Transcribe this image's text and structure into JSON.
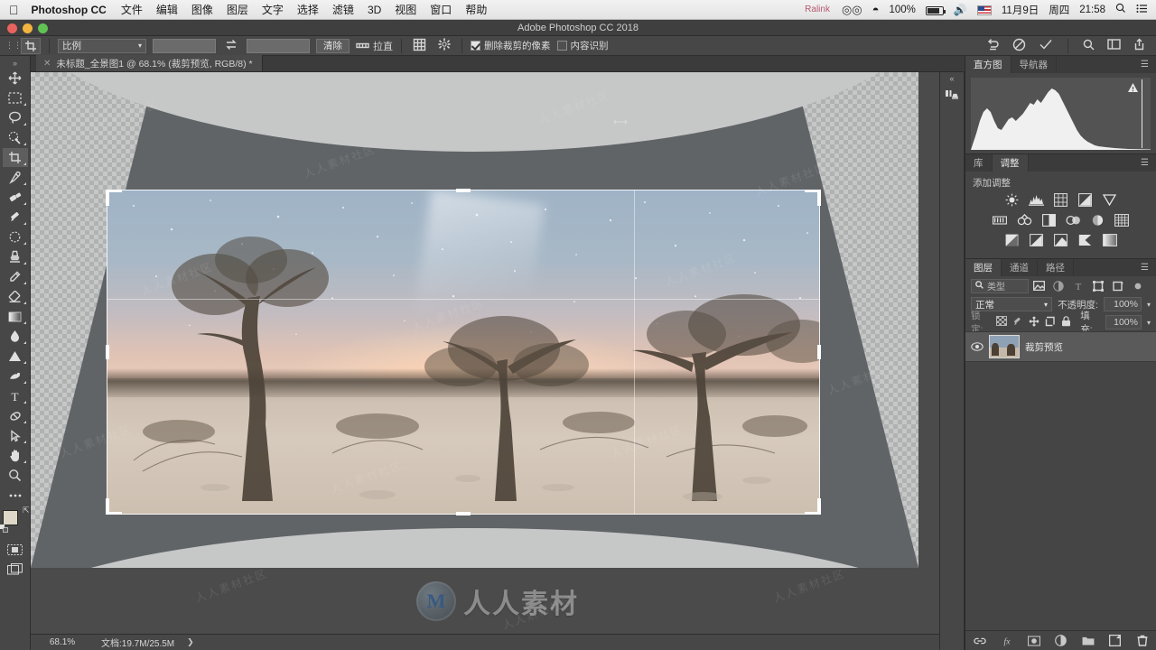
{
  "macbar": {
    "apple_icon": "apple-icon",
    "app_name": "Photoshop CC",
    "menus": [
      "文件",
      "编辑",
      "图像",
      "图层",
      "文字",
      "选择",
      "滤镜",
      "3D",
      "视图",
      "窗口",
      "帮助"
    ],
    "ralink_label": "Ralink",
    "battery_percent": "100%",
    "date": "11月9日",
    "weekday": "周四",
    "time": "21:58",
    "icons": [
      "wifi-icon",
      "battery-icon",
      "volume-icon",
      "flag-icon",
      "spotlight-search-icon",
      "notification-center-icon"
    ]
  },
  "titlebar": {
    "title": "Adobe Photoshop CC 2018",
    "window_buttons": [
      "close-button",
      "minimize-button",
      "zoom-button"
    ]
  },
  "options_bar": {
    "tool_icon": "crop-tool-icon",
    "ratio_select": {
      "label": "比例",
      "value": ""
    },
    "swap_icon": "swap-dimensions-icon",
    "width_value": "",
    "height_value": "",
    "clear_button": "清除",
    "straighten_icon": "straighten-icon",
    "straighten_label": "拉直",
    "overlay_icon": "crop-overlay-grid-icon",
    "settings_icon": "gear-icon",
    "delete_cropped_checkbox": {
      "label": "删除裁剪的像素",
      "checked": true
    },
    "content_aware_checkbox": {
      "label": "内容识别",
      "checked": false
    },
    "reset_icon": "reset-icon",
    "cancel_icon": "cancel-icon",
    "commit_icon": "commit-checkmark-icon",
    "right_icons": [
      "search-icon",
      "workspace-icon",
      "share-icon"
    ]
  },
  "document_tab": {
    "close_icon": "close-tab-icon",
    "title": "未标题_全景图1 @ 68.1% (裁剪预览, RGB/8) *"
  },
  "toolbar": {
    "collapse_icon": "expand-toolbar-icon",
    "tools": [
      {
        "name": "move-tool",
        "active": false
      },
      {
        "name": "rectangular-marquee-tool",
        "active": false
      },
      {
        "name": "lasso-tool",
        "active": false
      },
      {
        "name": "quick-selection-tool",
        "active": false
      },
      {
        "name": "crop-tool",
        "active": true
      },
      {
        "name": "eyedropper-tool",
        "active": false
      },
      {
        "name": "spot-healing-brush-tool",
        "active": false
      },
      {
        "name": "brush-tool",
        "active": false
      },
      {
        "name": "patch-tool",
        "active": false
      },
      {
        "name": "clone-stamp-tool",
        "active": false
      },
      {
        "name": "history-brush-tool",
        "active": false
      },
      {
        "name": "eraser-tool",
        "active": false
      },
      {
        "name": "gradient-tool",
        "active": false
      },
      {
        "name": "blur-tool",
        "active": false
      },
      {
        "name": "dodge-tool",
        "active": false
      },
      {
        "name": "pen-tool",
        "active": false
      },
      {
        "name": "type-tool",
        "active": false
      },
      {
        "name": "path-selection-tool",
        "active": false
      },
      {
        "name": "direct-selection-tool",
        "active": false
      },
      {
        "name": "hand-tool",
        "active": false
      },
      {
        "name": "zoom-tool",
        "active": false
      },
      {
        "name": "more-tools",
        "active": false
      }
    ],
    "foreground_color": "#ded6c6",
    "background_color": "#e6dcdc",
    "quickmask_icon": "quick-mask-icon",
    "screenmode_icon": "screen-mode-icon"
  },
  "canvas": {
    "zoom_level": "68.1%",
    "watermark_text": "人人素材",
    "watermark_logo": "renren-logo-icon",
    "tiled_watermark": "人人素材社区",
    "crop_overlay": {
      "rule_of_thirds": true,
      "handles": 8
    }
  },
  "status_bar": {
    "zoom": "68.1%",
    "doc_size": "文档:19.7M/25.5M",
    "expand_icon": "expand-status-icon"
  },
  "dock_strip": {
    "collapse_icon": "collapse-panels-icon",
    "icons": [
      "libraries-icon"
    ]
  },
  "histogram_panel": {
    "tabs": [
      {
        "label": "直方图",
        "active": true
      },
      {
        "label": "导航器",
        "active": false
      }
    ],
    "menu_icon": "panel-menu-icon",
    "warning_icon": "cache-warning-icon"
  },
  "adjustments_panel": {
    "tabs": [
      {
        "label": "库",
        "active": false
      },
      {
        "label": "调整",
        "active": true
      }
    ],
    "menu_icon": "panel-menu-icon",
    "title": "添加调整",
    "rows": [
      [
        "brightness-contrast-icon",
        "levels-icon",
        "curves-icon",
        "exposure-icon",
        "vibrance-icon"
      ],
      [
        "hue-saturation-icon",
        "color-balance-icon",
        "black-white-icon",
        "photo-filter-icon",
        "channel-mixer-icon",
        "color-lookup-icon"
      ],
      [
        "invert-icon",
        "posterize-icon",
        "threshold-icon",
        "selective-color-icon",
        "gradient-map-icon"
      ]
    ]
  },
  "layers_panel": {
    "tabs": [
      {
        "label": "图层",
        "active": true
      },
      {
        "label": "通道",
        "active": false
      },
      {
        "label": "路径",
        "active": false
      }
    ],
    "menu_icon": "panel-menu-icon",
    "filter": {
      "search_icon": "filter-search-icon",
      "label": "类型",
      "icons": [
        "filter-pixel-icon",
        "filter-adjustment-icon",
        "filter-type-icon",
        "filter-shape-icon",
        "filter-smart-icon"
      ],
      "toggle_icon": "filter-toggle-icon"
    },
    "blend_mode": "正常",
    "opacity_label": "不透明度:",
    "opacity_value": "100%",
    "lock_label": "锁定:",
    "lock_icons": [
      "lock-transparent-icon",
      "lock-image-icon",
      "lock-position-icon",
      "lock-artboard-icon",
      "lock-all-icon"
    ],
    "fill_label": "填充:",
    "fill_value": "100%",
    "layers": [
      {
        "name": "裁剪预览",
        "visible": true,
        "selected": true,
        "thumbnail": "layer-thumbnail"
      }
    ],
    "footer_icons": [
      "link-layers-icon",
      "fx-icon",
      "add-mask-icon",
      "new-adjustment-icon",
      "new-group-icon",
      "new-layer-icon",
      "delete-layer-icon"
    ]
  },
  "colors": {
    "panel_bg": "#3b3b3b",
    "panel_mid": "#454545",
    "toolbar_bg": "#474747",
    "canvas_bg": "#4b4b4b",
    "accent_text": "#d8d8d8"
  }
}
